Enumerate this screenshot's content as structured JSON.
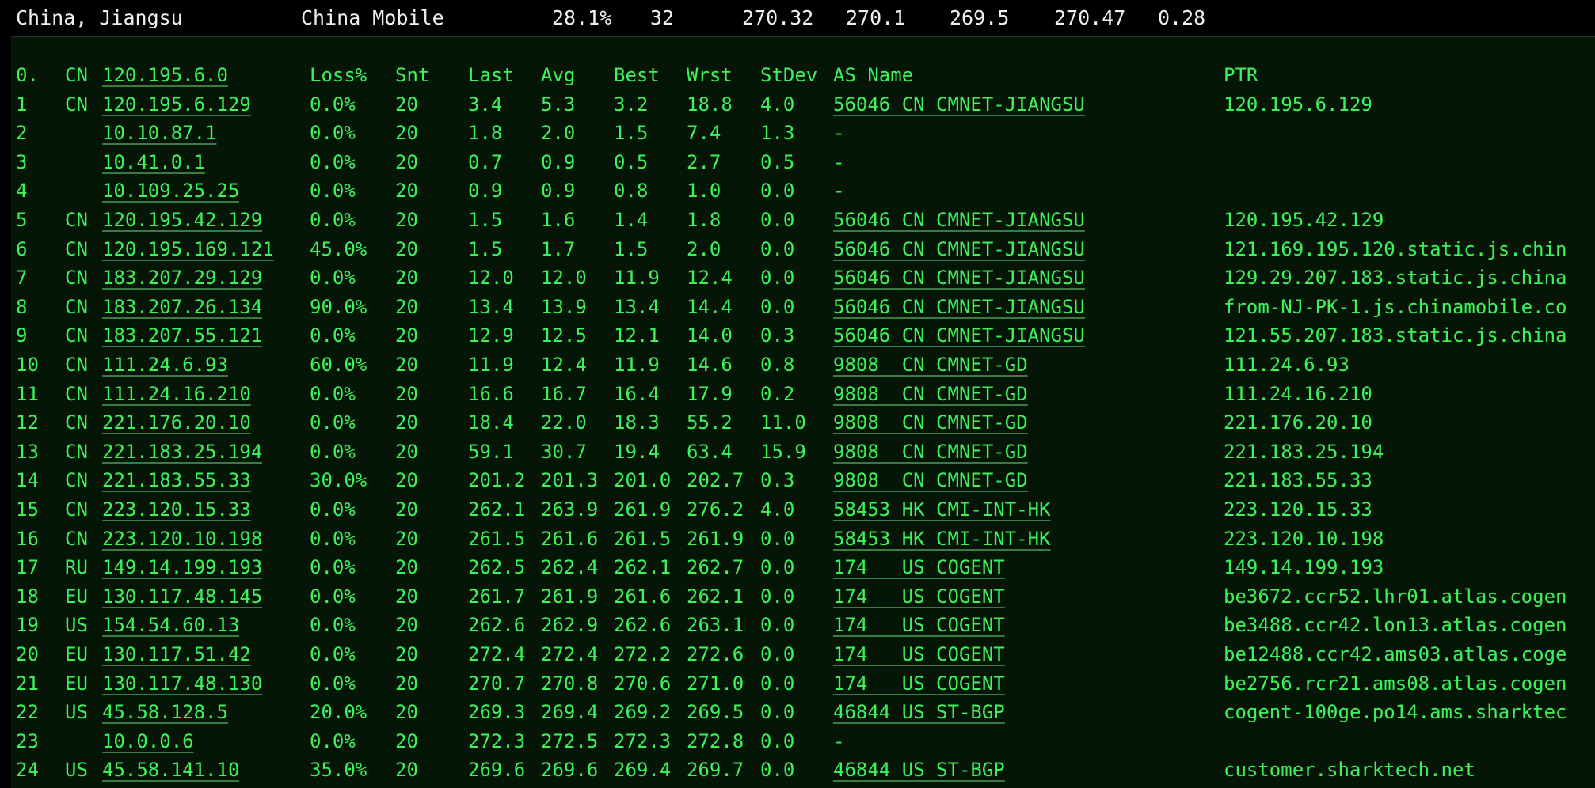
{
  "summary": {
    "location": "China, Jiangsu",
    "isp": "China Mobile",
    "loss": "28.1%",
    "snt": "32",
    "last": "270.32",
    "avg": "270.1",
    "best": "269.5",
    "wrst": "270.47",
    "stdev": "0.28"
  },
  "header": {
    "hop": "0.",
    "cc": "CN",
    "host": "120.195.6.0",
    "loss": "Loss%",
    "snt": "Snt",
    "last": "Last",
    "avg": "Avg",
    "best": "Best",
    "wrst": "Wrst",
    "stdev": "StDev",
    "as": "AS Name",
    "ptr": "PTR"
  },
  "hops": [
    {
      "hop": "1",
      "cc": "CN",
      "host": "120.195.6.129",
      "loss": "0.0%",
      "snt": "20",
      "last": "3.4",
      "avg": "5.3",
      "best": "3.2",
      "wrst": "18.8",
      "stdev": "4.0",
      "as": "56046 CN CMNET-JIANGSU",
      "ptr": "120.195.6.129"
    },
    {
      "hop": "2",
      "cc": "",
      "host": "10.10.87.1",
      "loss": "0.0%",
      "snt": "20",
      "last": "1.8",
      "avg": "2.0",
      "best": "1.5",
      "wrst": "7.4",
      "stdev": "1.3",
      "as": "-",
      "ptr": ""
    },
    {
      "hop": "3",
      "cc": "",
      "host": "10.41.0.1",
      "loss": "0.0%",
      "snt": "20",
      "last": "0.7",
      "avg": "0.9",
      "best": "0.5",
      "wrst": "2.7",
      "stdev": "0.5",
      "as": "-",
      "ptr": ""
    },
    {
      "hop": "4",
      "cc": "",
      "host": "10.109.25.25",
      "loss": "0.0%",
      "snt": "20",
      "last": "0.9",
      "avg": "0.9",
      "best": "0.8",
      "wrst": "1.0",
      "stdev": "0.0",
      "as": "-",
      "ptr": ""
    },
    {
      "hop": "5",
      "cc": "CN",
      "host": "120.195.42.129",
      "loss": "0.0%",
      "snt": "20",
      "last": "1.5",
      "avg": "1.6",
      "best": "1.4",
      "wrst": "1.8",
      "stdev": "0.0",
      "as": "56046 CN CMNET-JIANGSU",
      "ptr": "120.195.42.129"
    },
    {
      "hop": "6",
      "cc": "CN",
      "host": "120.195.169.121",
      "loss": "45.0%",
      "snt": "20",
      "last": "1.5",
      "avg": "1.7",
      "best": "1.5",
      "wrst": "2.0",
      "stdev": "0.0",
      "as": "56046 CN CMNET-JIANGSU",
      "ptr": "121.169.195.120.static.js.chin"
    },
    {
      "hop": "7",
      "cc": "CN",
      "host": "183.207.29.129",
      "loss": "0.0%",
      "snt": "20",
      "last": "12.0",
      "avg": "12.0",
      "best": "11.9",
      "wrst": "12.4",
      "stdev": "0.0",
      "as": "56046 CN CMNET-JIANGSU",
      "ptr": "129.29.207.183.static.js.china"
    },
    {
      "hop": "8",
      "cc": "CN",
      "host": "183.207.26.134",
      "loss": "90.0%",
      "snt": "20",
      "last": "13.4",
      "avg": "13.9",
      "best": "13.4",
      "wrst": "14.4",
      "stdev": "0.0",
      "as": "56046 CN CMNET-JIANGSU",
      "ptr": "from-NJ-PK-1.js.chinamobile.co"
    },
    {
      "hop": "9",
      "cc": "CN",
      "host": "183.207.55.121",
      "loss": "0.0%",
      "snt": "20",
      "last": "12.9",
      "avg": "12.5",
      "best": "12.1",
      "wrst": "14.0",
      "stdev": "0.3",
      "as": "56046 CN CMNET-JIANGSU",
      "ptr": "121.55.207.183.static.js.china"
    },
    {
      "hop": "10",
      "cc": "CN",
      "host": "111.24.6.93",
      "loss": "60.0%",
      "snt": "20",
      "last": "11.9",
      "avg": "12.4",
      "best": "11.9",
      "wrst": "14.6",
      "stdev": "0.8",
      "as": "9808  CN CMNET-GD",
      "ptr": "111.24.6.93"
    },
    {
      "hop": "11",
      "cc": "CN",
      "host": "111.24.16.210",
      "loss": "0.0%",
      "snt": "20",
      "last": "16.6",
      "avg": "16.7",
      "best": "16.4",
      "wrst": "17.9",
      "stdev": "0.2",
      "as": "9808  CN CMNET-GD",
      "ptr": "111.24.16.210"
    },
    {
      "hop": "12",
      "cc": "CN",
      "host": "221.176.20.10",
      "loss": "0.0%",
      "snt": "20",
      "last": "18.4",
      "avg": "22.0",
      "best": "18.3",
      "wrst": "55.2",
      "stdev": "11.0",
      "as": "9808  CN CMNET-GD",
      "ptr": "221.176.20.10"
    },
    {
      "hop": "13",
      "cc": "CN",
      "host": "221.183.25.194",
      "loss": "0.0%",
      "snt": "20",
      "last": "59.1",
      "avg": "30.7",
      "best": "19.4",
      "wrst": "63.4",
      "stdev": "15.9",
      "as": "9808  CN CMNET-GD",
      "ptr": "221.183.25.194"
    },
    {
      "hop": "14",
      "cc": "CN",
      "host": "221.183.55.33",
      "loss": "30.0%",
      "snt": "20",
      "last": "201.2",
      "avg": "201.3",
      "best": "201.0",
      "wrst": "202.7",
      "stdev": "0.3",
      "as": "9808  CN CMNET-GD",
      "ptr": "221.183.55.33"
    },
    {
      "hop": "15",
      "cc": "CN",
      "host": "223.120.15.33",
      "loss": "0.0%",
      "snt": "20",
      "last": "262.1",
      "avg": "263.9",
      "best": "261.9",
      "wrst": "276.2",
      "stdev": "4.0",
      "as": "58453 HK CMI-INT-HK",
      "ptr": "223.120.15.33"
    },
    {
      "hop": "16",
      "cc": "CN",
      "host": "223.120.10.198",
      "loss": "0.0%",
      "snt": "20",
      "last": "261.5",
      "avg": "261.6",
      "best": "261.5",
      "wrst": "261.9",
      "stdev": "0.0",
      "as": "58453 HK CMI-INT-HK",
      "ptr": "223.120.10.198"
    },
    {
      "hop": "17",
      "cc": "RU",
      "host": "149.14.199.193",
      "loss": "0.0%",
      "snt": "20",
      "last": "262.5",
      "avg": "262.4",
      "best": "262.1",
      "wrst": "262.7",
      "stdev": "0.0",
      "as": "174   US COGENT",
      "ptr": "149.14.199.193"
    },
    {
      "hop": "18",
      "cc": "EU",
      "host": "130.117.48.145",
      "loss": "0.0%",
      "snt": "20",
      "last": "261.7",
      "avg": "261.9",
      "best": "261.6",
      "wrst": "262.1",
      "stdev": "0.0",
      "as": "174   US COGENT",
      "ptr": "be3672.ccr52.lhr01.atlas.cogen"
    },
    {
      "hop": "19",
      "cc": "US",
      "host": "154.54.60.13",
      "loss": "0.0%",
      "snt": "20",
      "last": "262.6",
      "avg": "262.9",
      "best": "262.6",
      "wrst": "263.1",
      "stdev": "0.0",
      "as": "174   US COGENT",
      "ptr": "be3488.ccr42.lon13.atlas.cogen"
    },
    {
      "hop": "20",
      "cc": "EU",
      "host": "130.117.51.42",
      "loss": "0.0%",
      "snt": "20",
      "last": "272.4",
      "avg": "272.4",
      "best": "272.2",
      "wrst": "272.6",
      "stdev": "0.0",
      "as": "174   US COGENT",
      "ptr": "be12488.ccr42.ams03.atlas.coge"
    },
    {
      "hop": "21",
      "cc": "EU",
      "host": "130.117.48.130",
      "loss": "0.0%",
      "snt": "20",
      "last": "270.7",
      "avg": "270.8",
      "best": "270.6",
      "wrst": "271.0",
      "stdev": "0.0",
      "as": "174   US COGENT",
      "ptr": "be2756.rcr21.ams08.atlas.cogen"
    },
    {
      "hop": "22",
      "cc": "US",
      "host": "45.58.128.5",
      "loss": "20.0%",
      "snt": "20",
      "last": "269.3",
      "avg": "269.4",
      "best": "269.2",
      "wrst": "269.5",
      "stdev": "0.0",
      "as": "46844 US ST-BGP",
      "ptr": "cogent-100ge.po14.ams.sharktec"
    },
    {
      "hop": "23",
      "cc": "",
      "host": "10.0.0.6",
      "loss": "0.0%",
      "snt": "20",
      "last": "272.3",
      "avg": "272.5",
      "best": "272.3",
      "wrst": "272.8",
      "stdev": "0.0",
      "as": "-",
      "ptr": ""
    },
    {
      "hop": "24",
      "cc": "US",
      "host": "45.58.141.10",
      "loss": "35.0%",
      "snt": "20",
      "last": "269.6",
      "avg": "269.6",
      "best": "269.4",
      "wrst": "269.7",
      "stdev": "0.0",
      "as": "46844 US ST-BGP",
      "ptr": "customer.sharktech.net"
    }
  ]
}
